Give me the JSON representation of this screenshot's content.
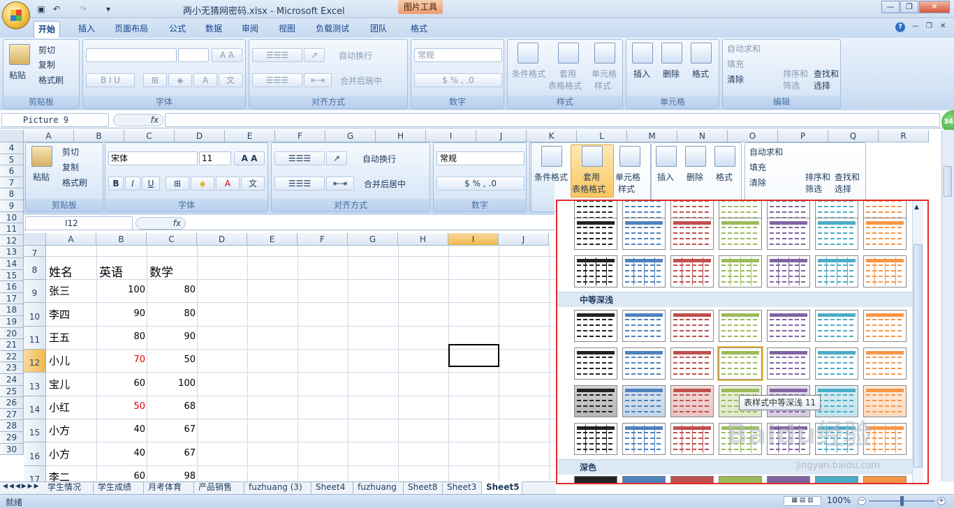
{
  "window": {
    "title": "两小无猜网密码.xlsx - Microsoft Excel",
    "context_tab": "图片工具",
    "minimize": "—",
    "restore": "❐",
    "close": "✕"
  },
  "quick_access": {
    "save_icon": "save-icon",
    "undo_icon": "undo-icon",
    "redo_icon": "redo-icon"
  },
  "tabs": [
    "开始",
    "插入",
    "页面布局",
    "公式",
    "数据",
    "审阅",
    "视图",
    "负载测试",
    "团队",
    "格式"
  ],
  "outer_ribbon": {
    "clipboard": {
      "paste": "粘贴",
      "cut": "剪切",
      "copy": "复制",
      "painter": "格式刷",
      "label": "剪贴板"
    },
    "font": {
      "label": "字体"
    },
    "alignment": {
      "wrap": "自动换行",
      "merge": "合并后居中",
      "label": "对齐方式"
    },
    "number": {
      "format": "常规",
      "label": "数字"
    },
    "styles": {
      "cond": "条件格式",
      "table1": "套用",
      "table2": "表格格式",
      "cell1": "单元格",
      "cell2": "样式",
      "label": "样式"
    },
    "cells": {
      "insert": "插入",
      "delete": "删除",
      "format": "格式",
      "label": "单元格"
    },
    "editing": {
      "autosum": "自动求和",
      "fill": "填充",
      "clear": "清除",
      "sort1": "排序和",
      "sort2": "筛选",
      "find1": "查找和",
      "find2": "选择",
      "label": "编辑"
    }
  },
  "outer_formula": {
    "name_box": "Picture 9",
    "fx": "fx"
  },
  "outer_columns": [
    "A",
    "B",
    "C",
    "D",
    "E",
    "F",
    "G",
    "H",
    "I",
    "J",
    "K",
    "L",
    "M",
    "N",
    "O",
    "P",
    "Q",
    "R"
  ],
  "outer_rows": [
    "4",
    "5",
    "6",
    "7",
    "8",
    "9",
    "10",
    "11",
    "12",
    "13",
    "14",
    "15",
    "16",
    "17",
    "18",
    "19",
    "20",
    "21",
    "22",
    "23",
    "24",
    "25",
    "26",
    "27",
    "28",
    "29",
    "30"
  ],
  "inner_ribbon": {
    "clipboard": {
      "paste": "粘贴",
      "cut": "剪切",
      "copy": "复制",
      "painter": "格式刷",
      "label": "剪贴板"
    },
    "font": {
      "name": "宋体",
      "size": "11",
      "bold": "B",
      "italic": "I",
      "underline": "U",
      "label": "字体"
    },
    "alignment": {
      "wrap": "自动换行",
      "merge": "合并后居中",
      "label": "对齐方式"
    },
    "number": {
      "format": "常规",
      "label": "数字"
    },
    "styles": {
      "cond": "条件格式",
      "table1": "套用",
      "table2": "表格格式",
      "cell1": "单元格",
      "cell2": "样式"
    },
    "cells": {
      "insert": "插入",
      "delete": "删除",
      "format": "格式"
    },
    "editing": {
      "autosum": "自动求和",
      "fill": "填充",
      "clear": "清除",
      "sort1": "排序和",
      "sort2": "筛选",
      "find1": "查找和",
      "find2": "选择"
    }
  },
  "inner_formula": {
    "name_box": "I12",
    "fx": "fx"
  },
  "inner_columns": [
    "A",
    "B",
    "C",
    "D",
    "E",
    "F",
    "G",
    "H",
    "I",
    "J"
  ],
  "inner_rows": [
    "7",
    "8",
    "9",
    "10",
    "11",
    "12",
    "13",
    "14",
    "15",
    "16",
    "17"
  ],
  "table": {
    "headers": [
      "姓名",
      "英语",
      "数学"
    ],
    "rows": [
      {
        "name": "张三",
        "eng": "100",
        "math": "80",
        "eng_red": false
      },
      {
        "name": "李四",
        "eng": "90",
        "math": "80",
        "eng_red": false
      },
      {
        "name": "王五",
        "eng": "80",
        "math": "90",
        "eng_red": false
      },
      {
        "name": "小儿",
        "eng": "70",
        "math": "50",
        "eng_red": true
      },
      {
        "name": "宝儿",
        "eng": "60",
        "math": "100",
        "eng_red": false
      },
      {
        "name": "小红",
        "eng": "50",
        "math": "68",
        "eng_red": true
      },
      {
        "name": "小方",
        "eng": "40",
        "math": "67",
        "eng_red": false
      },
      {
        "name": "小方",
        "eng": "40",
        "math": "67",
        "eng_red": false
      },
      {
        "name": "李二",
        "eng": "60",
        "math": "98",
        "eng_red": false
      }
    ]
  },
  "gallery": {
    "section_medium": "中等深浅",
    "section_dark": "深色",
    "tooltip": "表样式中等深浅 11",
    "colors": [
      "#222222",
      "#4f81bd",
      "#c0504d",
      "#9bbb59",
      "#8064a2",
      "#4bacc6",
      "#f79646"
    ]
  },
  "sheet_tabs": [
    "学生情况",
    "学生成绩",
    "月考体育",
    "产品销售",
    "fuzhuang (3)",
    "Sheet4",
    "fuzhuang",
    "Sheet8",
    "Sheet3",
    "Sheet5"
  ],
  "status": {
    "ready": "就绪",
    "zoom": "100%"
  },
  "badge": "34",
  "watermark": {
    "main": "Baidu经验",
    "sub": "jingyan.baidu.com"
  }
}
